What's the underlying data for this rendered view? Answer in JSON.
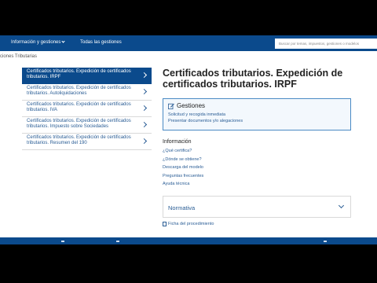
{
  "nav": {
    "menu_label": "Información y gestiones",
    "all_label": "Todas las gestiones",
    "search_placeholder": "Buscar por temas, impuestos, gestiones o modelos"
  },
  "breadcrumb": "ciones Tributarias",
  "sidebar": {
    "items": [
      {
        "label": "Certificados tributarios. Expedición de certificados tributarios. IRPF"
      },
      {
        "label": "Certificados tributarios. Expedición de certificados tributarios. Autoliquidaciones"
      },
      {
        "label": "Certificados tributarios. Expedición de certificados tributarios. IVA"
      },
      {
        "label": "Certificados tributarios. Expedición de certificados tributarios. Impuesto sobre Sociedades"
      },
      {
        "label": "Certificados tributarios. Expedición de certificados tributarios. Resumen del 190"
      }
    ]
  },
  "main": {
    "title": "Certificados tributarios. Expedición de certificados tributarios. IRPF",
    "gestiones": {
      "heading": "Gestiones",
      "links": [
        "Solicitud y recogida inmediata",
        "Presentar documentos y/o alegaciones"
      ]
    },
    "info": {
      "heading": "Información",
      "links": [
        "¿Qué certifica?",
        "¿Dónde se obtiene?",
        "Descarga del modelo",
        "Preguntas frecuentes",
        "Ayuda técnica"
      ]
    },
    "normativa_label": "Normativa",
    "ficha_label": "Ficha del procedimiento"
  },
  "colors": {
    "brand": "#0b4a8c",
    "link": "#2a5d95",
    "panel_border": "#4a8ac4"
  }
}
